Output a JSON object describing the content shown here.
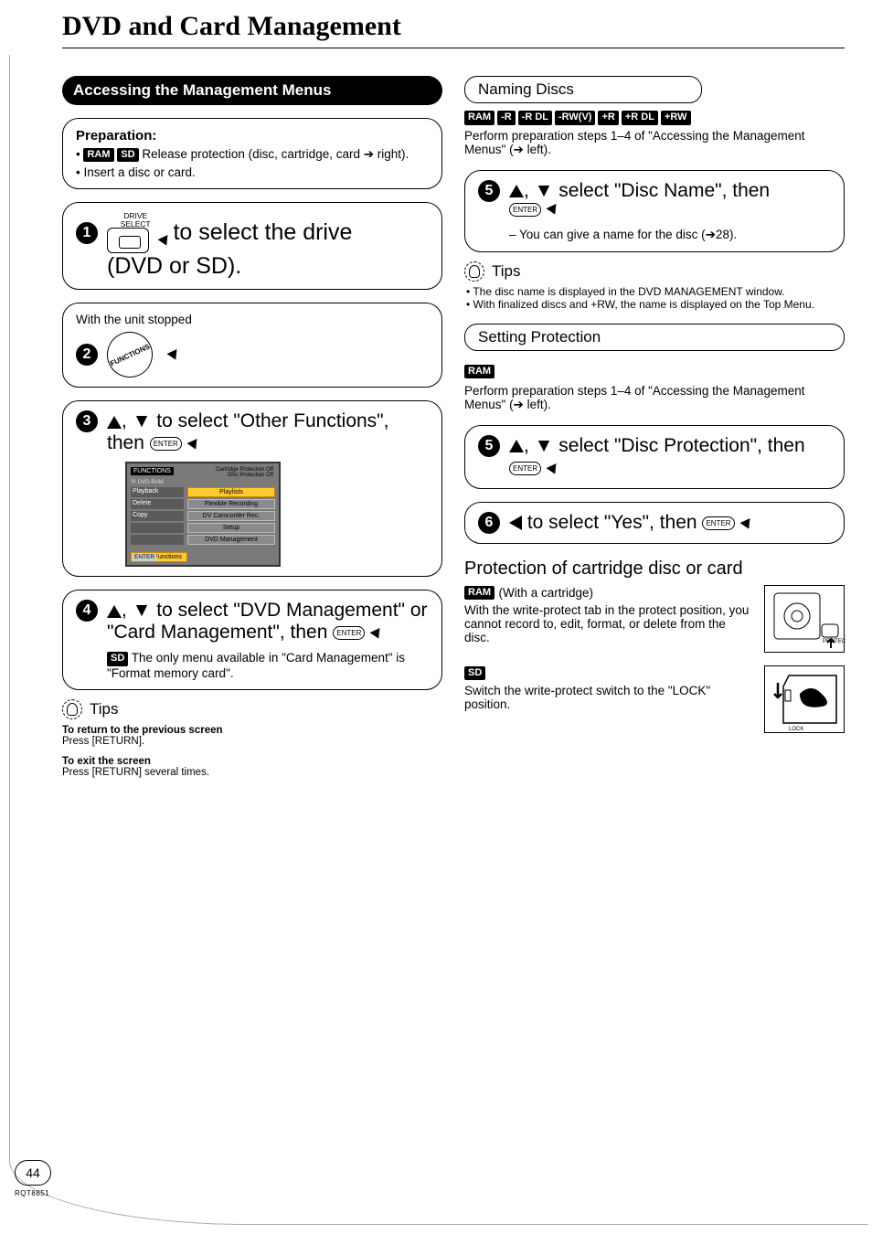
{
  "page": {
    "title": "DVD and Card Management",
    "number": "44",
    "doc_code": "RQT8851"
  },
  "left": {
    "section_title": "Accessing the Management Menus",
    "prep": {
      "heading": "Preparation:",
      "chips1": [
        "RAM",
        "SD"
      ],
      "line1": "Release protection (disc, cartridge, card ➔ right).",
      "line2": "Insert a disc or card."
    },
    "step1": {
      "drive_label_top": "DRIVE",
      "drive_label_bot": "SELECT",
      "text_a": "to select the drive",
      "text_b": "(DVD or SD)."
    },
    "step2": {
      "caption": "With the unit stopped",
      "wheel": "FUNCTIONS"
    },
    "step3": {
      "text": ", ▼ to select \"Other Functions\", then",
      "menu": {
        "brand": "FUNCTIONS",
        "info1": "Cartridge Protection   Off",
        "info2": "Disc Protection   Off",
        "disc": "DVD-RAM",
        "left_items": [
          "Playback",
          "Delete",
          "Copy"
        ],
        "right_items": [
          "Playlists",
          "Flexible Recording",
          "DV Camcorder Rec.",
          "Setup",
          "DVD Management"
        ],
        "other_functions": "Other Functions",
        "enter": "ENTER"
      },
      "enter_label": "ENTER"
    },
    "step4": {
      "text": ", ▼ to select \"DVD Management\" or \"Card Management\", then",
      "sd_chip": "SD",
      "sd_note": "The only menu available in \"Card Management\" is \"Format memory card\".",
      "enter_label": "ENTER"
    },
    "tips": {
      "title": "Tips",
      "t1_h": "To return to the previous screen",
      "t1_b": "Press [RETURN].",
      "t2_h": "To exit the screen",
      "t2_b": "Press [RETURN] several times."
    }
  },
  "right": {
    "naming": {
      "title": "Naming Discs",
      "chips": [
        "RAM",
        "-R",
        "-R DL",
        "-RW(V)",
        "+R",
        "+R DL",
        "+RW"
      ],
      "intro": "Perform preparation steps 1–4 of \"Accessing the Management Menus\" (➔ left).",
      "step5": {
        "text": ", ▼ select \"Disc Name\", then",
        "note": "– You can give a name for the disc (➔28).",
        "enter_label": "ENTER"
      },
      "tips_title": "Tips",
      "tips": [
        "The disc name is displayed in the DVD MANAGEMENT window.",
        "With finalized discs and +RW, the name is displayed on the Top Menu."
      ]
    },
    "protection": {
      "title": "Setting Protection",
      "chip": "RAM",
      "intro": "Perform preparation steps 1–4 of \"Accessing the Management Menus\" (➔ left).",
      "step5": {
        "text": ", ▼ select \"Disc Protection\", then",
        "enter_label": "ENTER"
      },
      "step6": {
        "text": " to select \"Yes\", then",
        "enter_label": "ENTER"
      }
    },
    "cartridge": {
      "heading": "Protection of cartridge disc or card",
      "ram_chip": "RAM",
      "ram_sub": "(With a cartridge)",
      "ram_text": "With the write-protect tab in the protect position, you cannot record to, edit, format, or delete from the disc.",
      "protect_label": "PROTECT",
      "sd_chip": "SD",
      "sd_text": "Switch the write-protect switch to the \"LOCK\" position.",
      "lock_label": "LOCK"
    }
  }
}
